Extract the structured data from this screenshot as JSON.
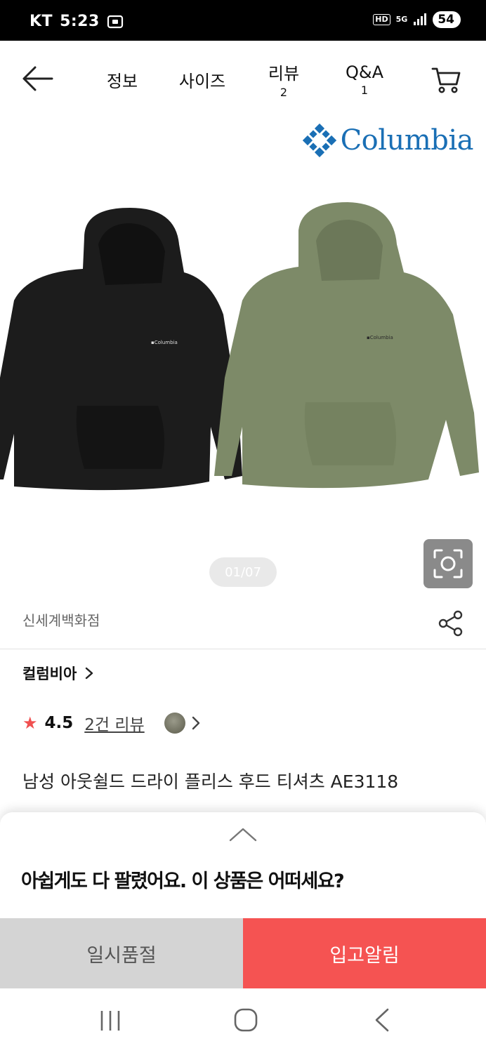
{
  "status_bar": {
    "carrier": "KT",
    "time": "5:23",
    "hd": "HD",
    "network": "5G",
    "battery": "54"
  },
  "nav": {
    "tabs": [
      {
        "label": "정보",
        "count": ""
      },
      {
        "label": "사이즈",
        "count": ""
      },
      {
        "label": "리뷰",
        "count": "2"
      },
      {
        "label": "Q&A",
        "count": "1"
      }
    ]
  },
  "product": {
    "brand_logo": "Columbia",
    "image_counter": "01/07",
    "store": "신세계백화점",
    "brand_link": "컬럼비아",
    "rating": "4.5",
    "review_link": "2건 리뷰",
    "title": "남성 아웃쉴드 드라이 플리스 후드 티셔츠 AE3118",
    "garment_colors": {
      "black": "#1c1c1c",
      "olive": "#7d8a68"
    }
  },
  "sheet": {
    "message": "아쉽게도 다 팔렸어요. 이 상품은 어떠세요?"
  },
  "actions": {
    "sold_out": "일시품절",
    "notify": "입고알림"
  },
  "colors": {
    "accent": "#f55352",
    "brand": "#1a6fb5",
    "star": "#f05050"
  },
  "icons": [
    "back-arrow-icon",
    "cart-icon",
    "lens-search-icon",
    "share-icon",
    "chevron-right-icon",
    "chevron-up-icon",
    "star-icon",
    "recent-apps-icon",
    "home-icon",
    "system-back-icon"
  ]
}
